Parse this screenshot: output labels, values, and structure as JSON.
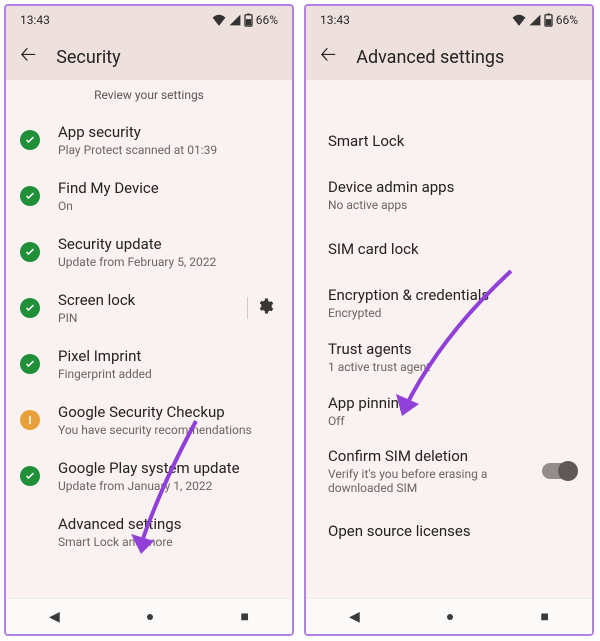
{
  "status": {
    "time": "13:43",
    "battery": "66%"
  },
  "left": {
    "title": "Security",
    "subheader": "Review your settings",
    "items": [
      {
        "badge": "green",
        "title": "App security",
        "sub": "Play Protect scanned at 01:39"
      },
      {
        "badge": "green",
        "title": "Find My Device",
        "sub": "On"
      },
      {
        "badge": "green",
        "title": "Security update",
        "sub": "Update from February 5, 2022"
      },
      {
        "badge": "green",
        "title": "Screen lock",
        "sub": "PIN",
        "gear": true
      },
      {
        "badge": "green",
        "title": "Pixel Imprint",
        "sub": "Fingerprint added"
      },
      {
        "badge": "amber",
        "title": "Google Security Checkup",
        "sub": "You have security recommendations"
      },
      {
        "badge": "green",
        "title": "Google Play system update",
        "sub": "Update from January 1, 2022"
      },
      {
        "badge": "",
        "title": "Advanced settings",
        "sub": "Smart Lock and more"
      }
    ]
  },
  "right": {
    "title": "Advanced settings",
    "items": [
      {
        "title": "Smart Lock",
        "sub": ""
      },
      {
        "title": "Device admin apps",
        "sub": "No active apps"
      },
      {
        "title": "SIM card lock",
        "sub": ""
      },
      {
        "title": "Encryption & credentials",
        "sub": "Encrypted"
      },
      {
        "title": "Trust agents",
        "sub": "1 active trust agent"
      },
      {
        "title": "App pinning",
        "sub": "Off"
      },
      {
        "title": "Confirm SIM deletion",
        "sub": "Verify it's you before erasing a downloaded SIM",
        "toggle": true
      },
      {
        "title": "Open source licenses",
        "sub": ""
      }
    ]
  }
}
